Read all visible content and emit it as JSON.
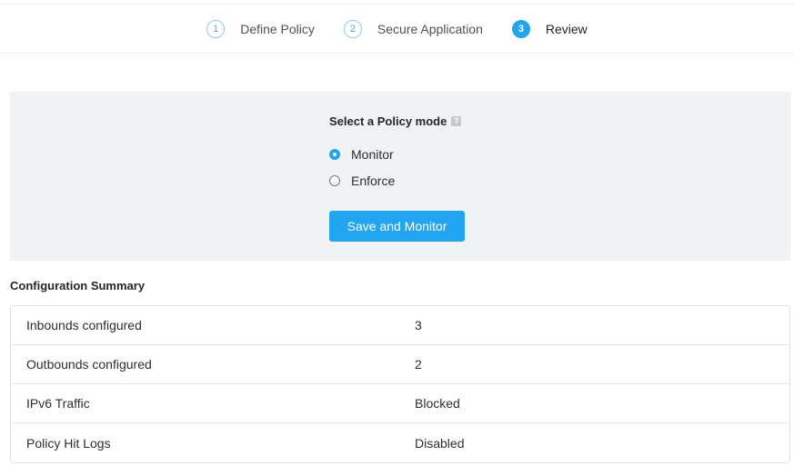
{
  "stepper": {
    "steps": [
      {
        "number": "1",
        "label": "Define Policy"
      },
      {
        "number": "2",
        "label": "Secure Application"
      },
      {
        "number": "3",
        "label": "Review"
      }
    ]
  },
  "policy_mode": {
    "title": "Select a Policy mode",
    "help_icon": "?",
    "options": [
      {
        "label": "Monitor",
        "selected": true
      },
      {
        "label": "Enforce",
        "selected": false
      }
    ],
    "save_label": "Save and Monitor"
  },
  "summary": {
    "title": "Configuration Summary",
    "rows": [
      {
        "label": "Inbounds configured",
        "value": "3"
      },
      {
        "label": "Outbounds configured",
        "value": "2"
      },
      {
        "label": "IPv6 Traffic",
        "value": "Blocked"
      },
      {
        "label": "Policy Hit Logs",
        "value": "Disabled"
      }
    ]
  },
  "colors": {
    "accent": "#22a5f1",
    "panel_bg": "#f1f2f4"
  }
}
